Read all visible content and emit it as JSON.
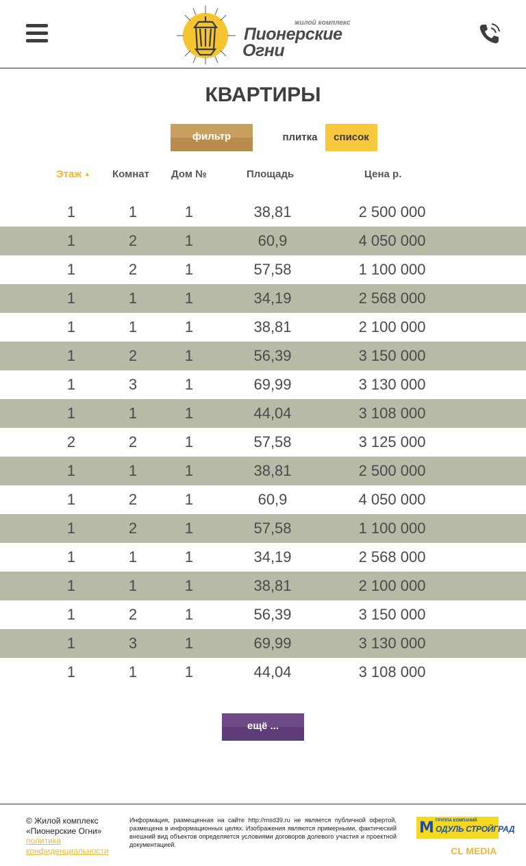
{
  "header": {
    "logo_small": "жилой комплекс",
    "logo_line1": "Пионерские",
    "logo_line2": "Огни",
    "menu_icon": "hamburger-menu-icon",
    "phone_icon": "phone-icon"
  },
  "page": {
    "title": "КВАРТИРЫ"
  },
  "controls": {
    "filter_label": "фильтр",
    "view_tile_label": "плитка",
    "view_list_label": "список",
    "active_view": "список"
  },
  "table": {
    "columns": [
      "Этаж",
      "Комнат",
      "Дом №",
      "Площадь",
      "Цена р."
    ],
    "sorted_by": "Этаж",
    "rows": [
      [
        "1",
        "1",
        "1",
        "38,81",
        "2 500 000"
      ],
      [
        "1",
        "2",
        "1",
        "60,9",
        "4 050 000"
      ],
      [
        "1",
        "2",
        "1",
        "57,58",
        "1 100 000"
      ],
      [
        "1",
        "1",
        "1",
        "34,19",
        "2 568 000"
      ],
      [
        "1",
        "1",
        "1",
        "38,81",
        "2 100 000"
      ],
      [
        "1",
        "2",
        "1",
        "56,39",
        "3 150 000"
      ],
      [
        "1",
        "3",
        "1",
        "69,99",
        "3 130 000"
      ],
      [
        "1",
        "1",
        "1",
        "44,04",
        "3 108 000"
      ],
      [
        "2",
        "2",
        "1",
        "57,58",
        "3 125 000"
      ],
      [
        "1",
        "1",
        "1",
        "38,81",
        "2 500 000"
      ],
      [
        "1",
        "2",
        "1",
        "60,9",
        "4 050 000"
      ],
      [
        "1",
        "2",
        "1",
        "57,58",
        "1 100 000"
      ],
      [
        "1",
        "1",
        "1",
        "34,19",
        "2 568 000"
      ],
      [
        "1",
        "1",
        "1",
        "38,81",
        "2 100 000"
      ],
      [
        "1",
        "2",
        "1",
        "56,39",
        "3 150 000"
      ],
      [
        "1",
        "3",
        "1",
        "69,99",
        "3 130 000"
      ],
      [
        "1",
        "1",
        "1",
        "44,04",
        "3 108 000"
      ]
    ]
  },
  "more_label": "ещё ...",
  "footer": {
    "copyright_line1": "© Жилой комплекс",
    "copyright_line2": "«Пионерские Огни»",
    "policy_line1": "политика",
    "policy_line2": "конфиденциальности",
    "info": "Информация, размещенная на сайте http://msd39.ru не является публичной офертой, размещена в информационных целях. Изображения являются примерными, фактический внешний вид объектов определяется условиями договоров долевого участия и проектной документацией.",
    "partner_small": "ГРУППА КОМПАНИЙ",
    "partner_letter": "М",
    "partner_name": "ОДУЛЬ СТРОЙГРАД",
    "developer": "CL MEDIA"
  },
  "colors": {
    "accent_yellow": "#f2b634",
    "filter_brown": "#b88c4e",
    "row_alt": "#b7baa6",
    "more_purple": "#5e3c77"
  }
}
